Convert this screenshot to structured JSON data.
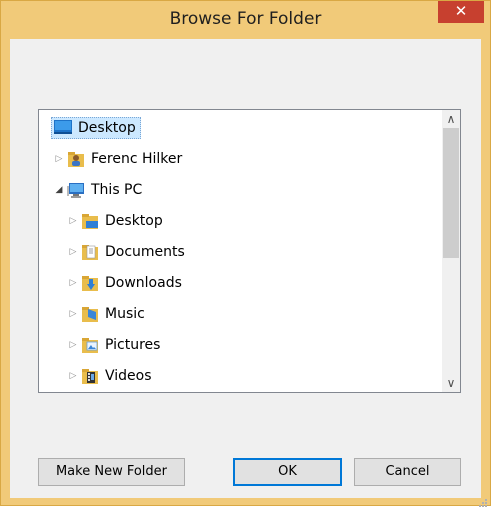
{
  "window": {
    "title": "Browse For Folder",
    "close_label": "✕"
  },
  "tree": {
    "items": [
      {
        "label": "Desktop",
        "selected": true
      },
      {
        "label": "Ferenc Hilker"
      },
      {
        "label": "This PC"
      },
      {
        "label": "Desktop"
      },
      {
        "label": "Documents"
      },
      {
        "label": "Downloads"
      },
      {
        "label": "Music"
      },
      {
        "label": "Pictures"
      },
      {
        "label": "Videos"
      }
    ]
  },
  "scrollbar": {
    "up": "∧",
    "down": "∨"
  },
  "buttons": {
    "make_new_folder": "Make New Folder",
    "ok": "OK",
    "cancel": "Cancel"
  },
  "colors": {
    "title_bar": "#f1ca79",
    "close": "#c7402f",
    "selection": "#cce8ff",
    "default_button_border": "#0078d7"
  }
}
